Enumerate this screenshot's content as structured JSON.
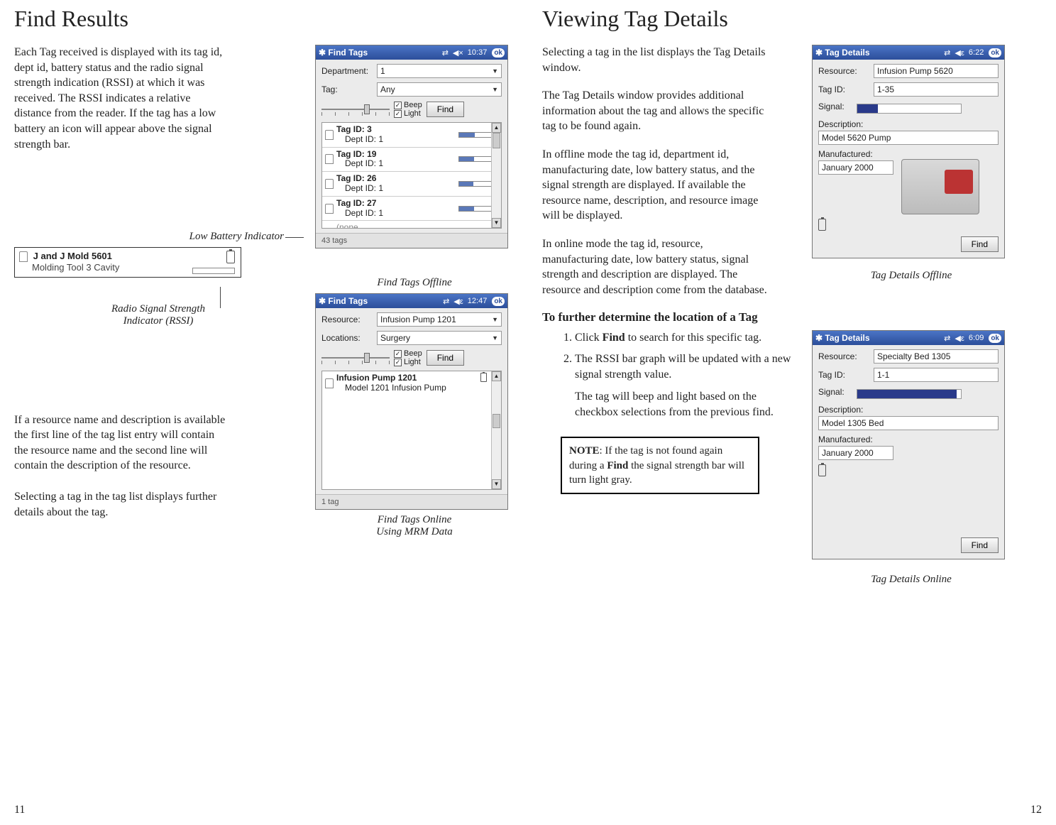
{
  "left": {
    "title": "Find Results",
    "para1": "Each Tag received is displayed with its tag id, dept id, battery status and the radio signal strength indication (RSSI) at which it was received.  The RSSI indicates a relative distance from the reader.  If the tag has a low battery an icon will appear above the signal strength bar.",
    "annot_batt": "Low Battery Indicator",
    "annot_rssi1": "Radio Signal Strength",
    "annot_rssi2": "Indicator (RSSI)",
    "detail_row": {
      "l1": "J and J Mold 5601",
      "l2": "Molding Tool 3 Cavity"
    },
    "para2": "If a resource name and description is available the first line of the tag list entry will contain the resource name and the second line will contain the description of the resource.",
    "para3": "Selecting a tag in the tag list displays further details about the tag.",
    "caption1": "Find Tags Offline",
    "caption2a": "Find Tags Online",
    "caption2b": "Using MRM Data",
    "page": "11"
  },
  "right": {
    "title": "Viewing Tag Details",
    "p1": "Selecting a tag in the list displays the Tag Details window.",
    "p2": "The Tag Details window provides additional information about the tag and allows the specific tag to be found again.",
    "p3": "In offline mode the tag id, department id, manufacturing date, low battery status, and the signal strength are displayed.  If available the resource name, description, and resource image will be displayed.",
    "p4": "In online mode the tag id, resource, manufacturing date, low battery status, signal strength and description are displayed.  The resource and description come from the database.",
    "subhead": "To further determine the location of a Tag",
    "step1a": "Click ",
    "step1b": "Find",
    "step1c": " to search for this specific tag.",
    "step2a": "The RSSI bar graph will be updated with a new signal strength value.",
    "step2b": "The tag will beep and light based on the checkbox selections from the previous find.",
    "note_a": "NOTE",
    "note_b": ": If the tag is not found again during a ",
    "note_c": "Find",
    "note_d": " the signal strength bar will turn light gray.",
    "caption1": "Tag Details Offline",
    "caption2": "Tag Details Online",
    "page": "12"
  },
  "pda_findtags_offline": {
    "title": "Find Tags",
    "clock": "10:37",
    "ok": "ok",
    "dept_label": "Department:",
    "dept_value": "1",
    "tag_label": "Tag:",
    "tag_value": "Any",
    "beep": "Beep",
    "light": "Light",
    "find_btn": "Find",
    "items": [
      {
        "l1": "Tag ID: 3",
        "l2": "Dept ID: 1",
        "rssi": 42
      },
      {
        "l1": "Tag ID: 19",
        "l2": "Dept ID: 1",
        "rssi": 40
      },
      {
        "l1": "Tag ID: 26",
        "l2": "Dept ID: 1",
        "rssi": 38
      },
      {
        "l1": "Tag ID: 27",
        "l2": "Dept ID: 1",
        "rssi": 40
      },
      {
        "l1": "(none",
        "l2": "(none)",
        "rssi": 0
      }
    ],
    "status": "43 tags"
  },
  "pda_findtags_online": {
    "title": "Find Tags",
    "clock": "12:47",
    "ok": "ok",
    "res_label": "Resource:",
    "res_value": "Infusion Pump 1201",
    "loc_label": "Locations:",
    "loc_value": "Surgery",
    "beep": "Beep",
    "light": "Light",
    "find_btn": "Find",
    "item_l1": "Infusion Pump 1201",
    "item_l2": "Model 1201 Infusion Pump",
    "status": "1 tag"
  },
  "pda_tagdetails_offline": {
    "title": "Tag Details",
    "clock": "6:22",
    "ok": "ok",
    "res_label": "Resource:",
    "res_value": "Infusion Pump 5620",
    "tagid_label": "Tag ID:",
    "tagid_value": "1-35",
    "signal_label": "Signal:",
    "signal_pct": 20,
    "desc_label": "Description:",
    "desc_value": "Model 5620 Pump",
    "mfg_label": "Manufactured:",
    "mfg_value": "January 2000",
    "find_btn": "Find"
  },
  "pda_tagdetails_online": {
    "title": "Tag Details",
    "clock": "6:09",
    "ok": "ok",
    "res_label": "Resource:",
    "res_value": "Specialty Bed 1305",
    "tagid_label": "Tag ID:",
    "tagid_value": "1-1",
    "signal_label": "Signal:",
    "signal_pct": 96,
    "desc_label": "Description:",
    "desc_value": "Model 1305 Bed",
    "mfg_label": "Manufactured:",
    "mfg_value": "January 2000",
    "find_btn": "Find"
  }
}
